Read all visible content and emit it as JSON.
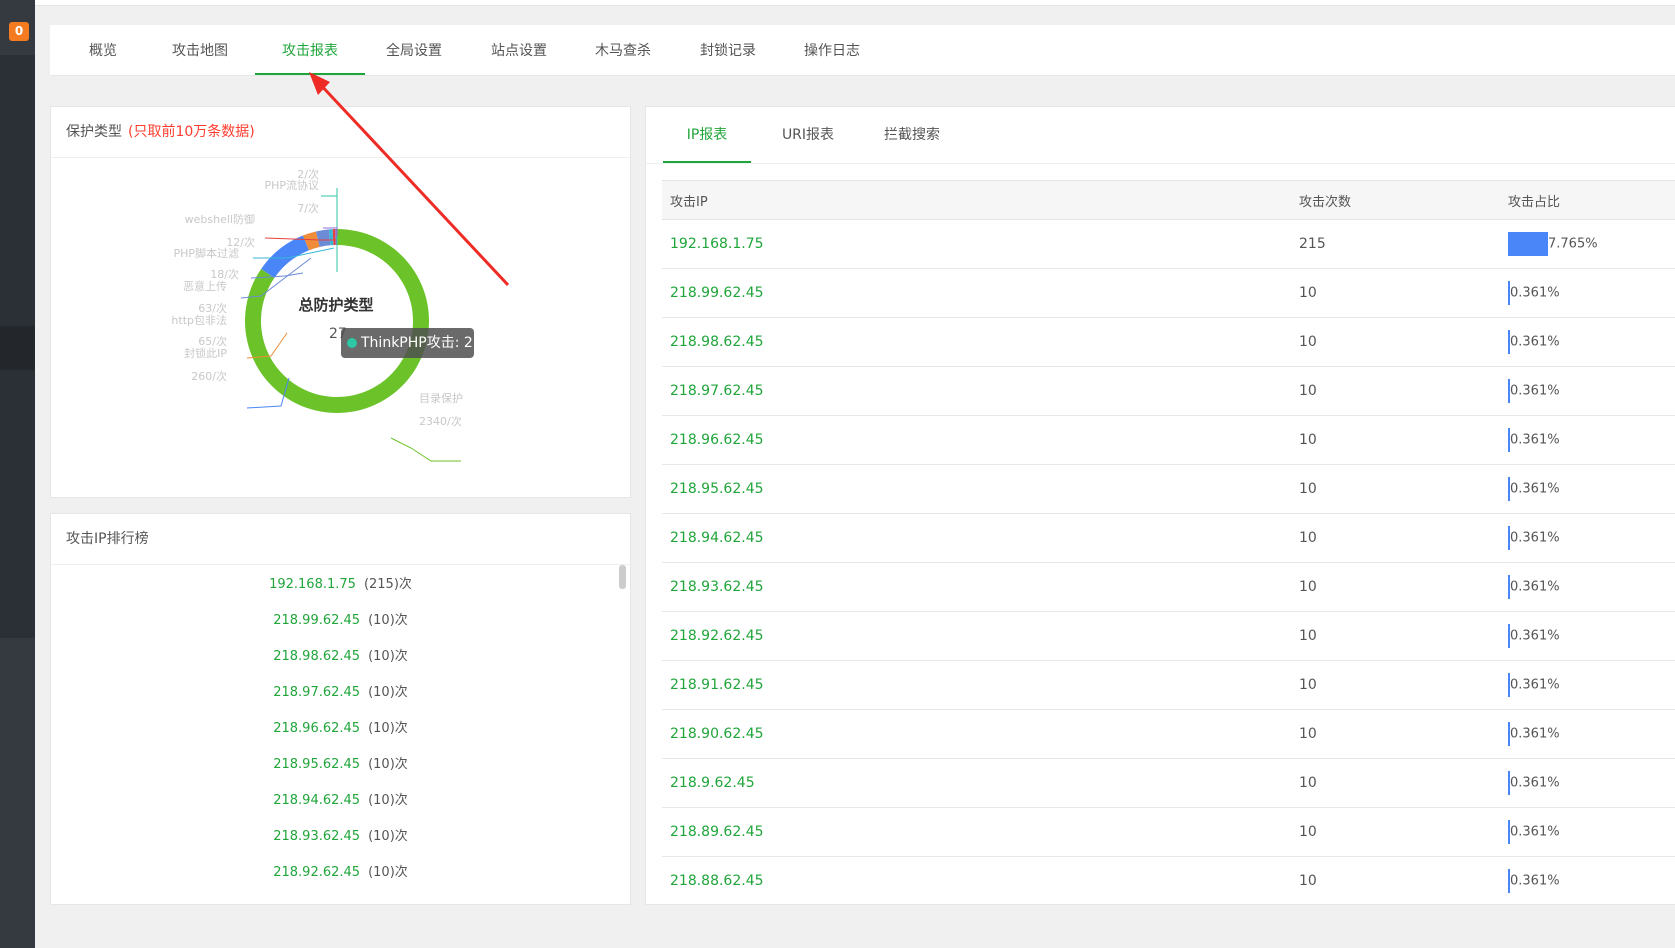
{
  "sidebar": {
    "badge": "0"
  },
  "tabs": [
    "概览",
    "攻击地图",
    "攻击报表",
    "全局设置",
    "站点设置",
    "木马查杀",
    "封锁记录",
    "操作日志"
  ],
  "active_tab_index": 2,
  "protection_panel": {
    "title": "保护类型",
    "note": "(只取前10万条数据)",
    "center_title": "总防护类型",
    "center_value": "27",
    "tooltip": "ThinkPHP攻击: 2",
    "labels": [
      {
        "name": "",
        "count": "2/次"
      },
      {
        "name": "PHP流协议",
        "count": "7/次"
      },
      {
        "name": "webshell防御",
        "count": "12/次"
      },
      {
        "name": "PHP脚本过滤",
        "count": "18/次"
      },
      {
        "name": "恶意上传",
        "count": "63/次"
      },
      {
        "name": "http包非法",
        "count": "65/次"
      },
      {
        "name": "封锁此IP",
        "count": "260/次"
      },
      {
        "name": "目录保护",
        "count": "2340/次"
      }
    ]
  },
  "chart_data": {
    "type": "pie",
    "title": "总防护类型",
    "categories": [
      "ThinkPHP攻击",
      "PHP流协议",
      "webshell防御",
      "PHP脚本过滤",
      "恶意上传",
      "http包非法",
      "封锁此IP",
      "目录保护"
    ],
    "values": [
      2,
      7,
      12,
      18,
      63,
      65,
      260,
      2340
    ],
    "colors": [
      "#2ec7a6",
      "#8e6bd1",
      "#e8423c",
      "#37b6d6",
      "#6b8bd6",
      "#f08c3a",
      "#4a86f7",
      "#6cc329"
    ]
  },
  "rank_panel": {
    "title": "攻击IP排行榜",
    "items": [
      {
        "ip": "192.168.1.75",
        "count": "(215)次"
      },
      {
        "ip": "218.99.62.45",
        "count": "(10)次"
      },
      {
        "ip": "218.98.62.45",
        "count": "(10)次"
      },
      {
        "ip": "218.97.62.45",
        "count": "(10)次"
      },
      {
        "ip": "218.96.62.45",
        "count": "(10)次"
      },
      {
        "ip": "218.95.62.45",
        "count": "(10)次"
      },
      {
        "ip": "218.94.62.45",
        "count": "(10)次"
      },
      {
        "ip": "218.93.62.45",
        "count": "(10)次"
      },
      {
        "ip": "218.92.62.45",
        "count": "(10)次"
      }
    ]
  },
  "report_panel": {
    "tabs": [
      "IP报表",
      "URI报表",
      "拦截搜索"
    ],
    "active_tab_index": 0,
    "columns": [
      "攻击IP",
      "攻击次数",
      "攻击占比"
    ],
    "rows": [
      {
        "ip": "192.168.1.75",
        "count": "215",
        "ratio": "7.765%",
        "ratio_value": 7.765
      },
      {
        "ip": "218.99.62.45",
        "count": "10",
        "ratio": "0.361%",
        "ratio_value": 0.361
      },
      {
        "ip": "218.98.62.45",
        "count": "10",
        "ratio": "0.361%",
        "ratio_value": 0.361
      },
      {
        "ip": "218.97.62.45",
        "count": "10",
        "ratio": "0.361%",
        "ratio_value": 0.361
      },
      {
        "ip": "218.96.62.45",
        "count": "10",
        "ratio": "0.361%",
        "ratio_value": 0.361
      },
      {
        "ip": "218.95.62.45",
        "count": "10",
        "ratio": "0.361%",
        "ratio_value": 0.361
      },
      {
        "ip": "218.94.62.45",
        "count": "10",
        "ratio": "0.361%",
        "ratio_value": 0.361
      },
      {
        "ip": "218.93.62.45",
        "count": "10",
        "ratio": "0.361%",
        "ratio_value": 0.361
      },
      {
        "ip": "218.92.62.45",
        "count": "10",
        "ratio": "0.361%",
        "ratio_value": 0.361
      },
      {
        "ip": "218.91.62.45",
        "count": "10",
        "ratio": "0.361%",
        "ratio_value": 0.361
      },
      {
        "ip": "218.90.62.45",
        "count": "10",
        "ratio": "0.361%",
        "ratio_value": 0.361
      },
      {
        "ip": "218.9.62.45",
        "count": "10",
        "ratio": "0.361%",
        "ratio_value": 0.361
      },
      {
        "ip": "218.89.62.45",
        "count": "10",
        "ratio": "0.361%",
        "ratio_value": 0.361
      },
      {
        "ip": "218.88.62.45",
        "count": "10",
        "ratio": "0.361%",
        "ratio_value": 0.361
      }
    ]
  }
}
